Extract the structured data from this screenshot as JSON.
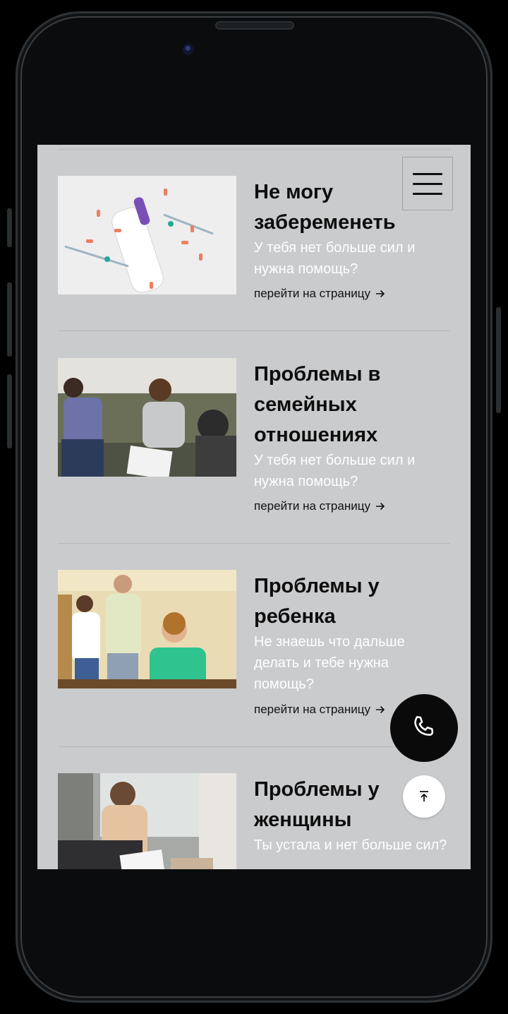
{
  "menu": {
    "icon": "hamburger-icon"
  },
  "cards": [
    {
      "title": "Не могу забеременеть",
      "description": "У тебя нет больше сил и нужна помощь?",
      "link": "перейти на страницу",
      "image": "pregnancy-test-photo"
    },
    {
      "title": "Проблемы в семейных отношениях",
      "description": "У тебя нет больше сил и нужна помощь?",
      "link": "перейти на страницу",
      "image": "couple-therapy-photo"
    },
    {
      "title": "Проблемы у ребенка",
      "description": "Не знаешь что дальше делать и тебе нужна помощь?",
      "link": "перейти на страницу",
      "image": "family-child-photo"
    },
    {
      "title": "Проблемы у женщины",
      "description": "Ты устала и нет больше сил?",
      "link": "",
      "image": "woman-therapy-photo"
    }
  ],
  "floating": {
    "call_icon": "phone-icon",
    "top_icon": "arrow-up-to-top-icon"
  },
  "colors": {
    "screen_bg": "#cacbcd",
    "title": "#0d0d0d",
    "description": "#ffffff",
    "call_button": "#0a0a0a"
  }
}
